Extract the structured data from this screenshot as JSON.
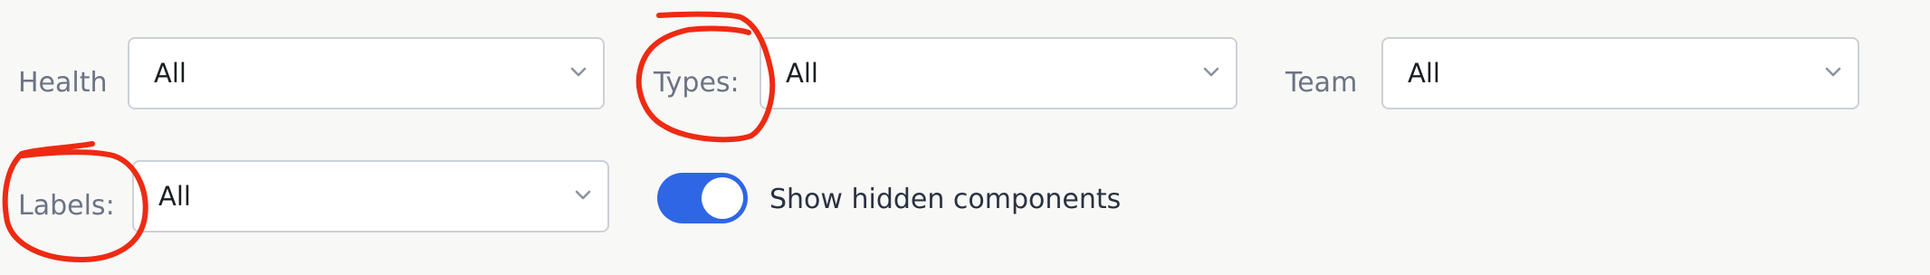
{
  "filters": {
    "health": {
      "label": "Health",
      "value": "All"
    },
    "types": {
      "label": "Types:",
      "value": "All"
    },
    "team": {
      "label": "Team",
      "value": "All"
    },
    "labels": {
      "label": "Labels:",
      "value": "All"
    }
  },
  "toggle": {
    "label": "Show hidden components",
    "on": true
  },
  "colors": {
    "accent": "#2f66e5",
    "annotation": "#ee2a12"
  }
}
